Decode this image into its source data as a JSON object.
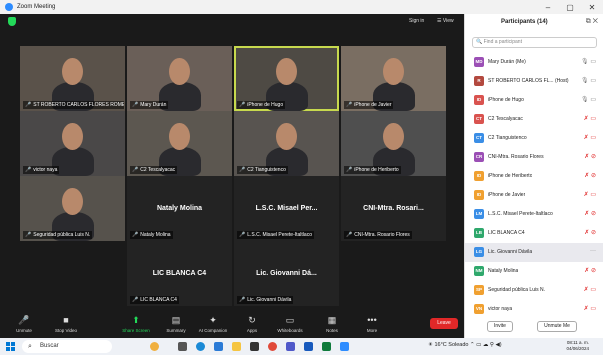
{
  "window": {
    "title": "Zoom Meeting",
    "controls": [
      "–",
      "▢",
      "✕"
    ]
  },
  "meeting": {
    "sign_in": "Sign in",
    "view": "View",
    "tiles": [
      {
        "id": "t1",
        "label": "ST ROBERTO CARLOS FLORES ROMERO",
        "type": "video"
      },
      {
        "id": "t2",
        "label": "Mary Durán",
        "type": "video"
      },
      {
        "id": "t3",
        "label": "iPhone de Hugo",
        "type": "video",
        "active": true
      },
      {
        "id": "t4",
        "label": "iPhone de Javier",
        "type": "video"
      },
      {
        "id": "t5",
        "label": "victor naya",
        "type": "video"
      },
      {
        "id": "t6",
        "label": "C2 Tescalyacac",
        "type": "video"
      },
      {
        "id": "t7",
        "label": "C2 Tianguistenco",
        "type": "video"
      },
      {
        "id": "t8",
        "label": "iPhone de Heriberto",
        "type": "video"
      },
      {
        "id": "t9",
        "label": "Seguridad pública Luis N.",
        "type": "video"
      },
      {
        "id": "t10",
        "label": "Nataly Molina",
        "big": "Nataly Molina",
        "type": "name"
      },
      {
        "id": "t11",
        "label": "L.S.C. Misael Perete-Italtlaco",
        "big": "L.S.C. Misael Per...",
        "type": "name"
      },
      {
        "id": "t12",
        "label": "CNI-Mtra. Rosario Flores",
        "big": "CNI-Mtra. Rosari...",
        "type": "name"
      },
      {
        "id": "t13",
        "label": "LIC BLANCA C4",
        "big": "LIC BLANCA C4",
        "type": "name"
      },
      {
        "id": "t14",
        "label": "Lic. Giovanni Dávila",
        "big": "Lic. Giovanni Dá...",
        "type": "name"
      }
    ]
  },
  "toolbar": {
    "items": [
      {
        "id": "unmute",
        "label": "Unmute",
        "icon": "mic-off-icon",
        "glyph": "🎤"
      },
      {
        "id": "stopvideo",
        "label": "Stop Video",
        "icon": "video-icon",
        "glyph": "■"
      },
      {
        "id": "share",
        "label": "Share Screen",
        "icon": "share-icon",
        "glyph": "⬆"
      },
      {
        "id": "summary",
        "label": "Summary",
        "icon": "summary-icon",
        "glyph": "▤"
      },
      {
        "id": "ai",
        "label": "AI Companion",
        "icon": "ai-sparkle-icon",
        "glyph": "✦"
      },
      {
        "id": "apps",
        "label": "Apps",
        "icon": "apps-icon",
        "glyph": "↻"
      },
      {
        "id": "whiteboards",
        "label": "Whiteboards",
        "icon": "whiteboard-icon",
        "glyph": "▭"
      },
      {
        "id": "notes",
        "label": "Notes",
        "icon": "notes-icon",
        "glyph": "▦"
      },
      {
        "id": "more",
        "label": "More",
        "icon": "more-icon",
        "glyph": "•••"
      }
    ],
    "leave": "Leave"
  },
  "participants": {
    "title": "Participants (14)",
    "search_placeholder": "Find a participant",
    "list": [
      {
        "initials": "MD",
        "color": "#9b4fb5",
        "name": "Mary Durán (Me)",
        "status": "🎙 ▭",
        "ok": true
      },
      {
        "initials": "R",
        "color": "#b3493f",
        "name": "ST ROBERTO CARLOS FL... (Host)",
        "status": "🎙 ▭",
        "ok": true
      },
      {
        "initials": "ID",
        "color": "#d9534f",
        "name": "iPhone de Hugo",
        "status": "🎙 ▭",
        "ok": true
      },
      {
        "initials": "CT",
        "color": "#d9534f",
        "name": "C2 Tescalyacac",
        "status": "✗ ▭"
      },
      {
        "initials": "CT",
        "color": "#3a8ee6",
        "name": "C2 Tianguistenco",
        "status": "✗ ▭"
      },
      {
        "initials": "CR",
        "color": "#9b4fb5",
        "name": "CNI-Mtra. Rosario Flores",
        "status": "✗ ⊘"
      },
      {
        "initials": "ID",
        "color": "#f0a030",
        "name": "iPhone de Heriberto",
        "status": "✗ ⊘"
      },
      {
        "initials": "ID",
        "color": "#f0a030",
        "name": "iPhone de Javier",
        "status": "✗ ▭"
      },
      {
        "initials": "LM",
        "color": "#3a8ee6",
        "name": "L.S.C. Misael Perete-Italtlaco",
        "status": "✗ ⊘"
      },
      {
        "initials": "LB",
        "color": "#2fa86c",
        "name": "LIC BLANCA C4",
        "status": "✗ ⊘"
      },
      {
        "initials": "LG",
        "color": "#3a8ee6",
        "name": "Lic. Giovanni Dávila",
        "status": "···",
        "ok": true,
        "hl": true
      },
      {
        "initials": "NM",
        "color": "#2fa86c",
        "name": "Nataly Molina",
        "status": "✗ ⊘"
      },
      {
        "initials": "SP",
        "color": "#f0a030",
        "name": "Seguridad pública Luis N.",
        "status": "✗ ▭"
      },
      {
        "initials": "VN",
        "color": "#f0a030",
        "name": "victor naya",
        "status": "✗ ▭"
      }
    ],
    "invite": "Invite",
    "unmute_me": "Unmute Me"
  },
  "taskbar": {
    "search": "Buscar",
    "weather": "16°C Soleado",
    "time": "08:11 a. m.",
    "date": "04/06/2024"
  }
}
